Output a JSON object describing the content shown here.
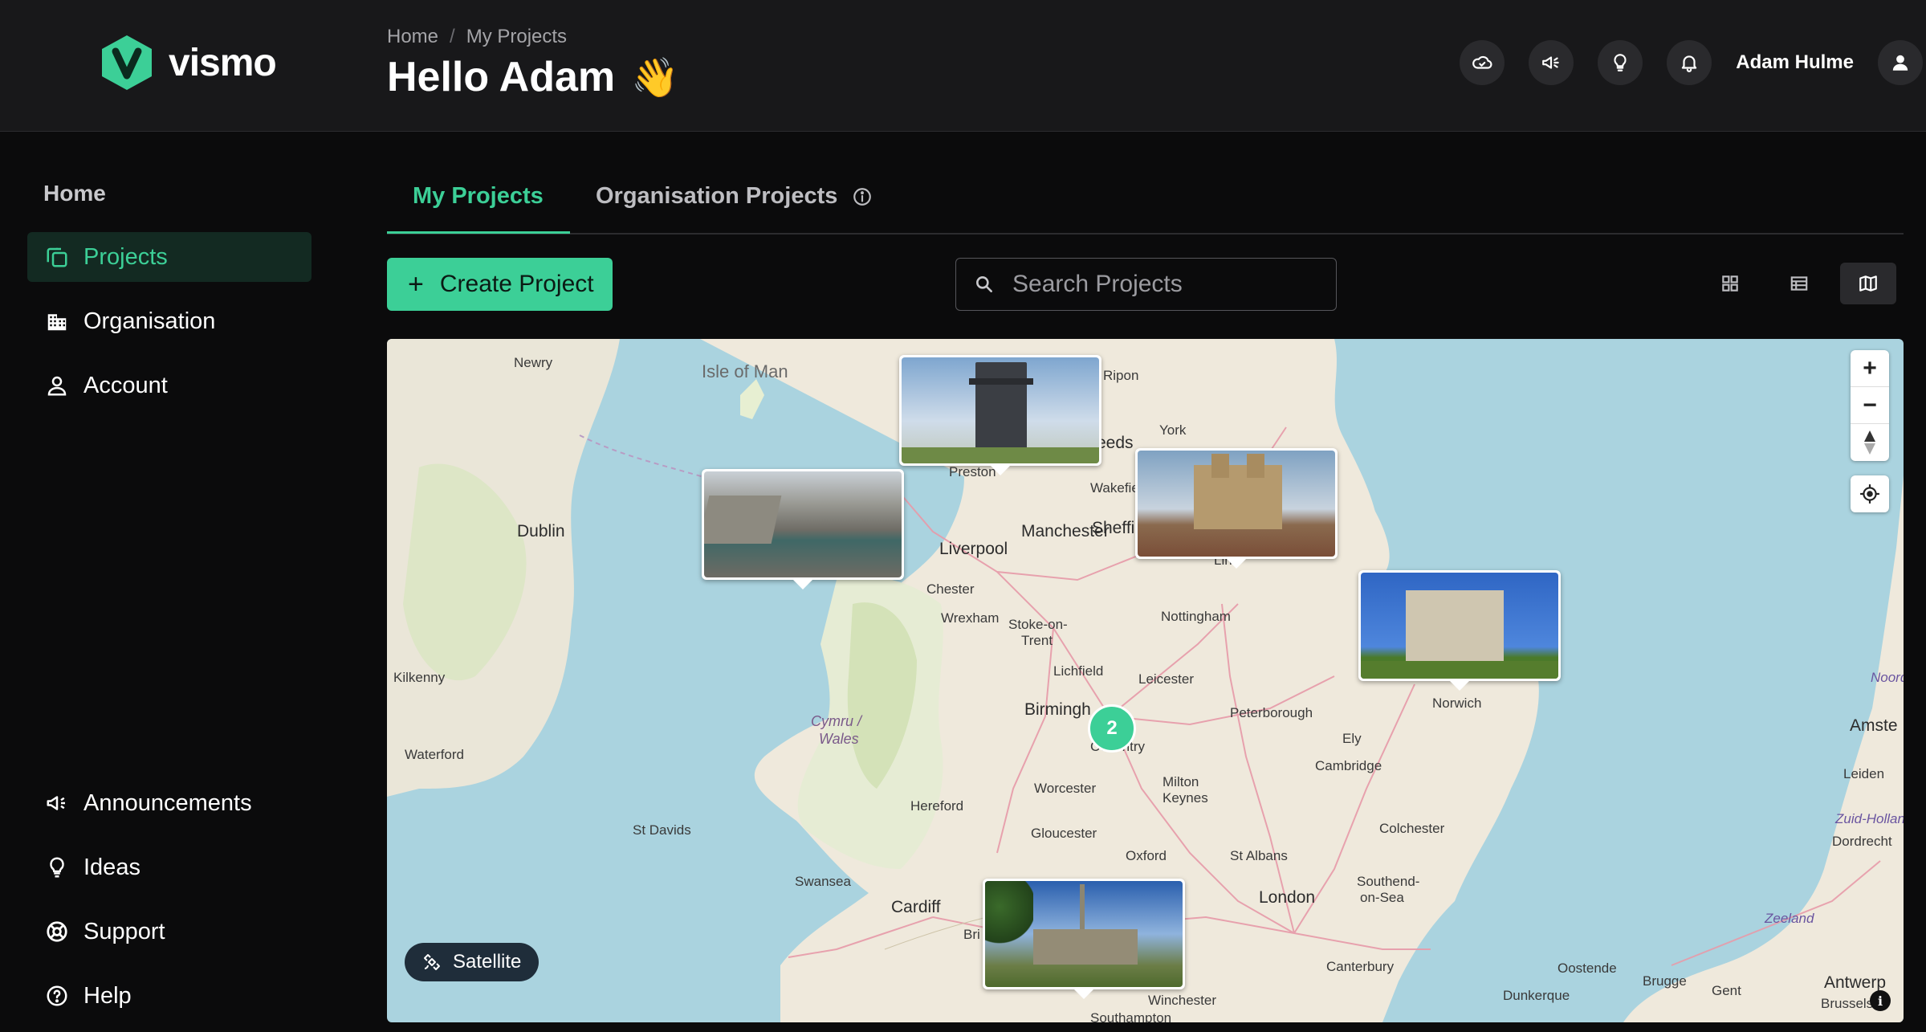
{
  "brand": {
    "name": "vismo",
    "color": "#3ccf97"
  },
  "header": {
    "breadcrumb": [
      "Home",
      "My Projects"
    ],
    "breadcrumb_separator": "/",
    "greeting": "Hello Adam",
    "greeting_emoji": "👋",
    "icons": [
      "cloud-icon",
      "megaphone-icon",
      "lightbulb-icon",
      "bell-icon"
    ],
    "user_name": "Adam Hulme"
  },
  "sidebar": {
    "home_label": "Home",
    "items": [
      {
        "label": "Projects",
        "icon": "projects-icon",
        "active": true
      },
      {
        "label": "Organisation",
        "icon": "building-icon",
        "active": false
      },
      {
        "label": "Account",
        "icon": "person-icon",
        "active": false
      }
    ],
    "bottom_items": [
      {
        "label": "Announcements",
        "icon": "megaphone-icon"
      },
      {
        "label": "Ideas",
        "icon": "lightbulb-icon"
      },
      {
        "label": "Support",
        "icon": "lifebuoy-icon"
      },
      {
        "label": "Help",
        "icon": "help-icon"
      }
    ]
  },
  "tabs": {
    "my_projects": "My Projects",
    "org_projects": "Organisation Projects"
  },
  "toolbar": {
    "create_label": "Create Project",
    "search_placeholder": "Search Projects",
    "views": [
      "grid-view-icon",
      "table-view-icon",
      "map-view-icon"
    ],
    "active_view": "map"
  },
  "map": {
    "labels": {
      "isle_of_man": "Isle of Man",
      "newry": "Newry",
      "dublin": "Dublin",
      "kilkenny": "Kilkenny",
      "waterford": "Waterford",
      "ripon": "Ripon",
      "york": "York",
      "leeds": "eeds",
      "preston": "Preston",
      "wakefield": "Wakefie",
      "liverpool": "Liverpool",
      "manchester": "Manchester",
      "sheffield": "Sheffi",
      "lincoln": "Lin",
      "chester": "Chester",
      "wrexham": "Wrexham",
      "stoke": "Stoke-on-",
      "trent": "Trent",
      "nottingham": "Nottingham",
      "lichfield": "Lichfield",
      "leicester": "Leicester",
      "birmingham": "Birmingh",
      "coventry": "Coventry",
      "peterborough": "Peterborough",
      "norwich": "Norwich",
      "ely": "Ely",
      "cymru": "Cymru /",
      "wales": "Wales",
      "cambridge": "Cambridge",
      "worcester": "Worcester",
      "milton": "Milton",
      "keynes": "Keynes",
      "hereford": "Hereford",
      "gloucester": "Gloucester",
      "oxford": "Oxford",
      "st_davids": "St Davids",
      "st_albans": "St Albans",
      "colchester": "Colchester",
      "swansea": "Swansea",
      "london": "London",
      "southend": "Southend-",
      "on_sea": "on-Sea",
      "cardiff": "Cardiff",
      "bristol": "Bri",
      "canterbury": "Canterbury",
      "winchester": "Winchester",
      "southampton": "Southampton",
      "oostende": "Oostende",
      "brugge": "Brugge",
      "gent": "Gent",
      "antwerp": "Antwerp",
      "brussels": "Brussels -",
      "leiden": "Leiden",
      "zuid_holland": "Zuid-Holland",
      "dordrecht": "Dordrecht",
      "zeeland": "Zeeland",
      "amsterdam": "Amste",
      "noord": "Noord",
      "dunkerque": "Dunkerque"
    },
    "cluster_count": "2",
    "satellite_label": "Satellite",
    "attribution": "i",
    "zoom_in": "+",
    "zoom_out": "−"
  }
}
